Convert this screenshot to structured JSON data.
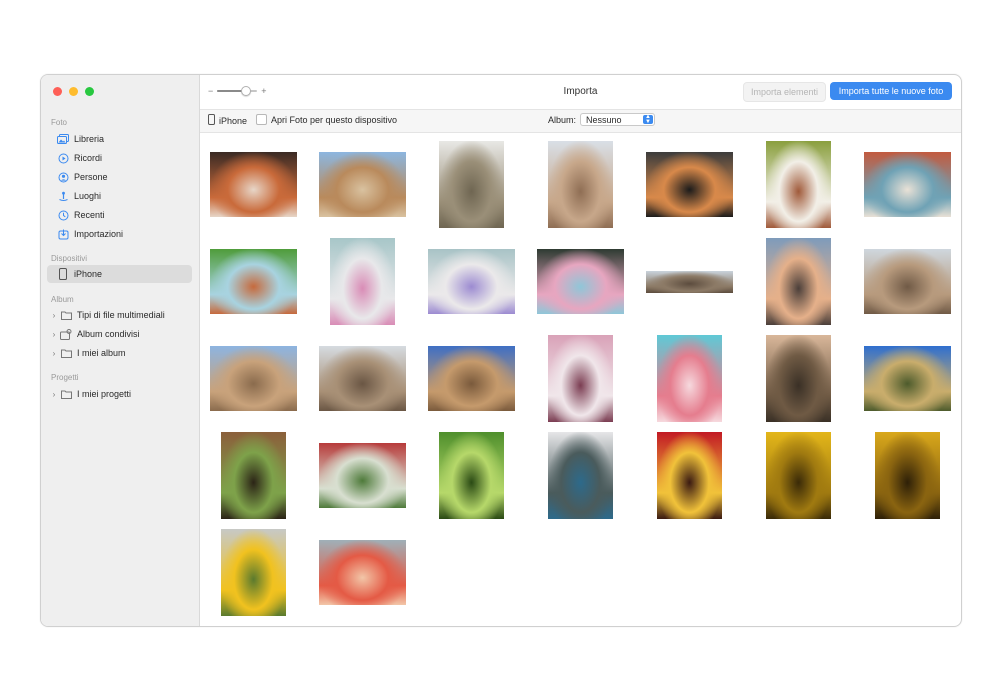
{
  "window": {
    "title": "Importa"
  },
  "toolbar": {
    "zoom_minus": "−",
    "zoom_plus": "+",
    "zoom_level": 0.75,
    "import_selected_label": "Importa elementi",
    "import_all_label": "Importa tutte le nuove foto"
  },
  "subbar": {
    "device_label": "iPhone",
    "open_photos_label": "Apri Foto per questo dispositivo",
    "open_photos_checked": false,
    "album_label": "Album:",
    "album_value": "Nessuno"
  },
  "sidebar": {
    "sections": [
      {
        "title": "Foto",
        "items": [
          {
            "label": "Libreria",
            "icon": "photo-library-icon"
          },
          {
            "label": "Ricordi",
            "icon": "memories-icon"
          },
          {
            "label": "Persone",
            "icon": "people-icon"
          },
          {
            "label": "Luoghi",
            "icon": "places-icon"
          },
          {
            "label": "Recenti",
            "icon": "recents-icon"
          },
          {
            "label": "Importazioni",
            "icon": "imports-icon"
          }
        ]
      },
      {
        "title": "Dispositivi",
        "items": [
          {
            "label": "iPhone",
            "icon": "iphone-icon",
            "selected": true
          }
        ]
      },
      {
        "title": "Album",
        "items": [
          {
            "label": "Tipi di file multimediali",
            "icon": "folder-icon"
          },
          {
            "label": "Album condivisi",
            "icon": "shared-album-icon"
          },
          {
            "label": "I miei album",
            "icon": "folder-icon"
          }
        ]
      },
      {
        "title": "Progetti",
        "items": [
          {
            "label": "I miei progetti",
            "icon": "folder-icon"
          }
        ]
      }
    ]
  },
  "colors": {
    "accent": "#3b8af0",
    "close": "#fe5f57",
    "minimize": "#febc2e",
    "zoom": "#28c840"
  },
  "photos": [
    {
      "subject": "dog on rug",
      "orientation": "landscape",
      "colors": [
        "#3a2a24",
        "#c96a3a",
        "#e7d6c8"
      ]
    },
    {
      "subject": "desert road",
      "orientation": "landscape",
      "colors": [
        "#8cb6df",
        "#b98a5c",
        "#d9c2a0"
      ]
    },
    {
      "subject": "plant stem",
      "orientation": "portrait",
      "colors": [
        "#e8e8e5",
        "#9a8f78",
        "#6f6652"
      ]
    },
    {
      "subject": "rock formation",
      "orientation": "portrait",
      "colors": [
        "#d9dfe6",
        "#c7a78a",
        "#8f6e54"
      ]
    },
    {
      "subject": "sunset over sea",
      "orientation": "landscape",
      "colors": [
        "#3c3c3c",
        "#d8894a",
        "#1b1b1b"
      ]
    },
    {
      "subject": "pastry plate",
      "orientation": "portrait",
      "colors": [
        "#8a9f3e",
        "#f2efe7",
        "#a05a3a"
      ]
    },
    {
      "subject": "pastry plate",
      "orientation": "landscape",
      "colors": [
        "#c25a3f",
        "#6fa2b5",
        "#e9e1d6"
      ]
    },
    {
      "subject": "pastry plate",
      "orientation": "landscape",
      "colors": [
        "#4f9c3b",
        "#a8d3e0",
        "#c66a3d"
      ]
    },
    {
      "subject": "macarons plate",
      "orientation": "portrait",
      "colors": [
        "#a7c6c8",
        "#e8e8ea",
        "#d98cb6"
      ]
    },
    {
      "subject": "macarons plate",
      "orientation": "landscape",
      "colors": [
        "#a8c3c6",
        "#ebe9ea",
        "#9c8bd1"
      ]
    },
    {
      "subject": "macaron tower",
      "orientation": "landscape",
      "colors": [
        "#2e3b32",
        "#e7a6c0",
        "#8fc6d8"
      ]
    },
    {
      "subject": "panorama mountains",
      "orientation": "panorama",
      "colors": [
        "#c9d3dc",
        "#8c7a66",
        "#5c4c3e"
      ]
    },
    {
      "subject": "mountain dusk",
      "orientation": "portrait",
      "colors": [
        "#7e9bbb",
        "#e5b08a",
        "#4b3f3a"
      ]
    },
    {
      "subject": "boulders",
      "orientation": "landscape",
      "colors": [
        "#cfd7de",
        "#b79a7d",
        "#705a46"
      ]
    },
    {
      "subject": "desert boulders",
      "orientation": "landscape",
      "colors": [
        "#8db4e0",
        "#c8a27b",
        "#8a6b4d"
      ]
    },
    {
      "subject": "desert valley",
      "orientation": "landscape",
      "colors": [
        "#d6dbe0",
        "#a89076",
        "#6a5644"
      ]
    },
    {
      "subject": "rock arch",
      "orientation": "landscape",
      "colors": [
        "#3f6fc4",
        "#c59a6c",
        "#7a5a3c"
      ]
    },
    {
      "subject": "pink table",
      "orientation": "portrait",
      "colors": [
        "#d9a2b8",
        "#f0e6ea",
        "#7b3d52"
      ]
    },
    {
      "subject": "pink cake",
      "orientation": "portrait",
      "colors": [
        "#5fc9d6",
        "#e57d8e",
        "#f6d9de"
      ]
    },
    {
      "subject": "dry grass dusk",
      "orientation": "portrait",
      "colors": [
        "#d9b79a",
        "#6f5a44",
        "#3a3026"
      ]
    },
    {
      "subject": "meadow",
      "orientation": "landscape",
      "colors": [
        "#2f6fcf",
        "#c9ad6c",
        "#4d5b2c"
      ]
    },
    {
      "subject": "aloe plant",
      "orientation": "portrait",
      "colors": [
        "#8b5f3b",
        "#7ea24a",
        "#2b2416"
      ]
    },
    {
      "subject": "allium flower",
      "orientation": "landscape",
      "colors": [
        "#b73b3b",
        "#d8dfd0",
        "#4e7a3a"
      ]
    },
    {
      "subject": "green leaf",
      "orientation": "portrait",
      "colors": [
        "#4f8f2c",
        "#b6d86a",
        "#2a4a14"
      ]
    },
    {
      "subject": "peacock feather",
      "orientation": "portrait",
      "colors": [
        "#e6e6e8",
        "#4a5b5c",
        "#2d6a8b"
      ]
    },
    {
      "subject": "red gerbera",
      "orientation": "portrait",
      "colors": [
        "#c21a24",
        "#f1c23a",
        "#3a1a12"
      ]
    },
    {
      "subject": "yellow gerbera",
      "orientation": "portrait",
      "colors": [
        "#e3b61a",
        "#a07a10",
        "#3a2a08"
      ]
    },
    {
      "subject": "yellow gerbera",
      "orientation": "portrait",
      "colors": [
        "#d9a81b",
        "#8a6410",
        "#2e2008"
      ]
    },
    {
      "subject": "single gerbera",
      "orientation": "portrait",
      "colors": [
        "#c7c9c6",
        "#f1c21f",
        "#5a7a2e"
      ]
    },
    {
      "subject": "grapefruit",
      "orientation": "landscape",
      "colors": [
        "#9fb0b8",
        "#e45a45",
        "#f2c6a8"
      ]
    }
  ]
}
